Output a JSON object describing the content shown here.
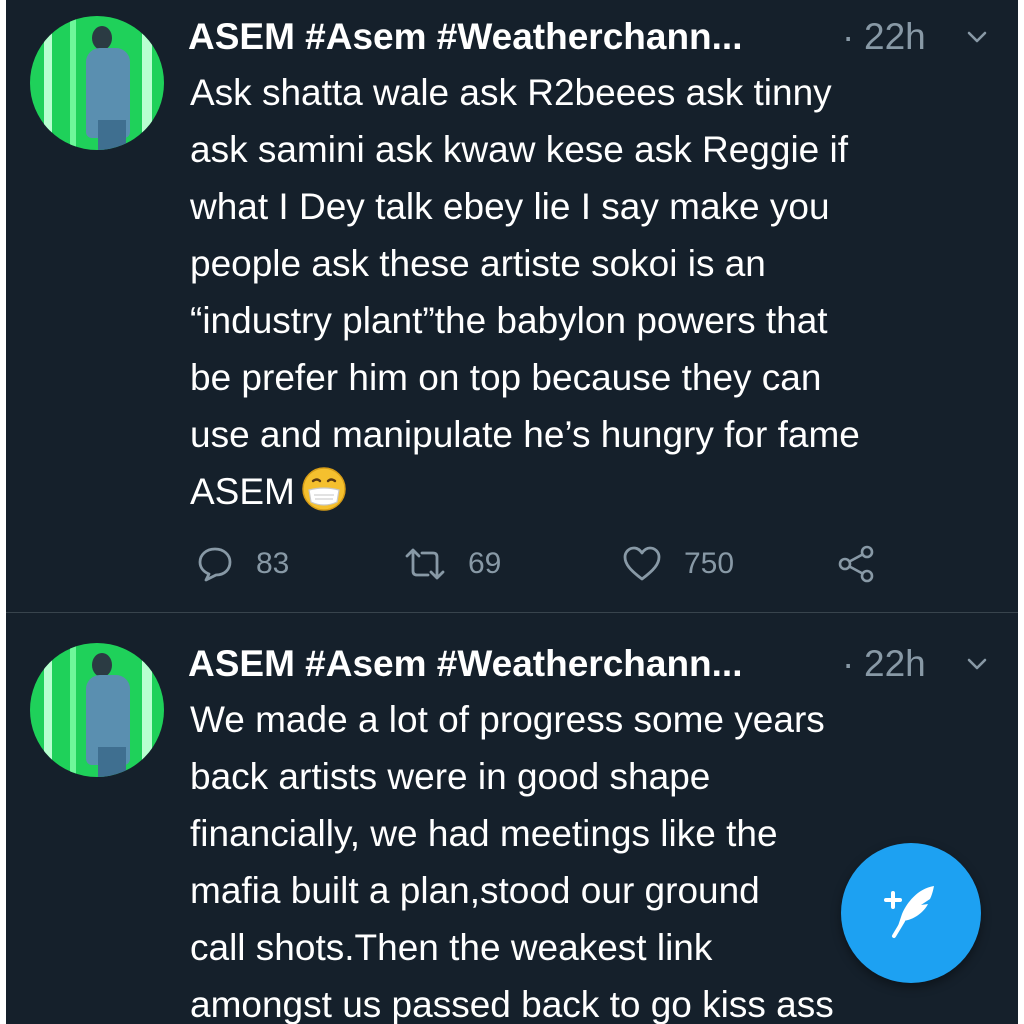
{
  "tweets": [
    {
      "author": "ASEM #Asem #Weatherchann...",
      "separator": "·",
      "time": "22h",
      "text": "Ask shatta wale ask R2beees ask tinny\nask samini ask kwaw kese ask Reggie if\nwhat I Dey talk ebey lie I say make you\npeople ask these artiste sokoi is an\n“industry plant”the babylon powers that\nbe prefer him on top because they can\nuse and manipulate he’s hungry for fame\nASEM",
      "emoji": "face-with-medical-mask-icon",
      "actions": {
        "replies": "83",
        "retweets": "69",
        "likes": "750"
      }
    },
    {
      "author": "ASEM #Asem #Weatherchann...",
      "separator": "·",
      "time": "22h",
      "text": "We made a lot of progress some years\nback artists were in good shape\nfinancially, we had meetings like the\nmafia built a plan,stood our ground\ncall shots.Then the weakest link\namongst us passed back to go kiss ass"
    }
  ],
  "icons": {
    "reply": "reply-icon",
    "retweet": "retweet-icon",
    "like": "like-icon",
    "share": "share-icon",
    "caret": "chevron-down-icon",
    "compose": "compose-tweet-icon"
  },
  "colors": {
    "background": "#15202b",
    "text": "#ffffff",
    "secondary": "#8899a6",
    "divider": "#38444d",
    "accent": "#1da1f2"
  }
}
